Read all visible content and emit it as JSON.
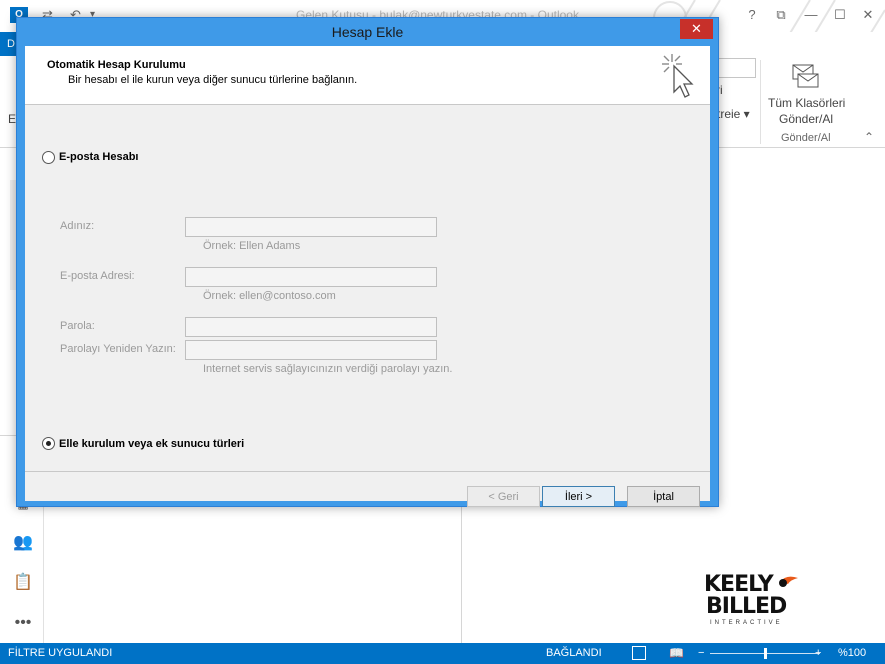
{
  "outlook": {
    "window_title": "Gelen Kutusu - bulak@newturkyestate.com - Outlook",
    "logo_letter": "O",
    "file_tab": "D",
    "ribbon_partial_1": "ri",
    "ribbon_partial_2": "treie",
    "ribbon_left_letter": "E-",
    "send_receive_all_line1": "Tüm Klasörleri",
    "send_receive_all_line2": "Gönder/Al",
    "send_receive_group": "Gönder/Al",
    "window_controls": {
      "help": "?",
      "restore_ribbon": "⧉",
      "minimize": "—",
      "maximize": "☐",
      "close": "✕"
    }
  },
  "dialog": {
    "title": "Hesap Ekle",
    "close_glyph": "✕",
    "header_title": "Otomatik Hesap Kurulumu",
    "header_subtitle": "Bir hesabı el ile kurun veya diğer sunucu türlerine bağlanın.",
    "option_email": {
      "label": "E-posta Hesabı",
      "selected": false
    },
    "fields": {
      "name_label": "Adınız:",
      "name_value": "",
      "name_hint": "Örnek: Ellen Adams",
      "email_label": "E-posta Adresi:",
      "email_value": "",
      "email_hint": "Örnek: ellen@contoso.com",
      "password_label": "Parola:",
      "password_value": "",
      "password_confirm_label": "Parolayı Yeniden Yazın:",
      "password_confirm_value": "",
      "password_hint": "Internet servis sağlayıcınızın verdiği parolayı yazın."
    },
    "option_manual": {
      "label": "Elle kurulum veya ek sunucu türleri",
      "selected": true
    },
    "buttons": {
      "back": "< Geri",
      "next": "İleri >",
      "cancel": "İptal"
    }
  },
  "statusbar": {
    "filter": "FİLTRE UYGULANDI",
    "connection": "BAĞLANDI",
    "zoom_minus": "−",
    "zoom_plus": "+",
    "zoom": "%100",
    "zoom_level": 0.5
  },
  "watermark": {
    "line1": "KEELY",
    "line2": "BILLED",
    "line3": "INTERACTIVE"
  }
}
